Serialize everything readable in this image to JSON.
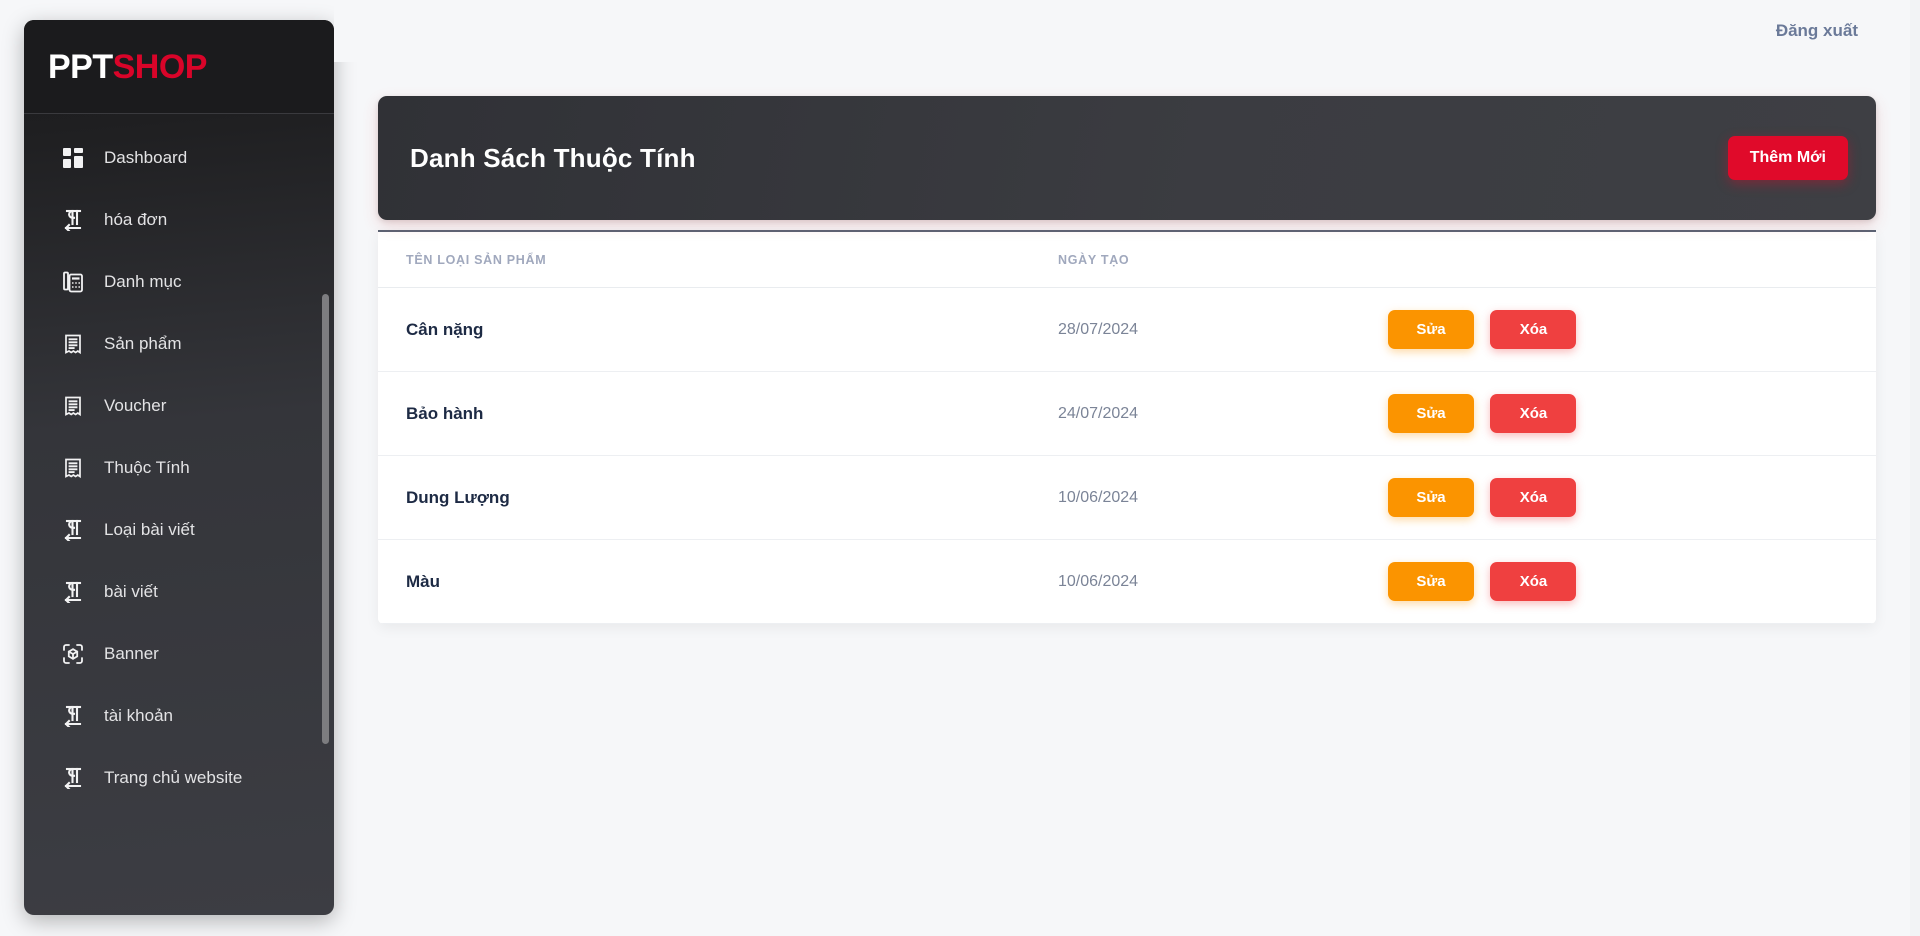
{
  "sidebar": {
    "logo": {
      "first": "PPT",
      "second": "SHOP"
    },
    "items": [
      {
        "label": "Dashboard",
        "icon": "dashboard-grid-icon"
      },
      {
        "label": "hóa đơn",
        "icon": "paragraph-mark-icon"
      },
      {
        "label": "Danh mục",
        "icon": "calculator-icon"
      },
      {
        "label": "Sản phẩm",
        "icon": "receipt-icon"
      },
      {
        "label": "Voucher",
        "icon": "receipt-icon"
      },
      {
        "label": "Thuộc Tính",
        "icon": "receipt-icon"
      },
      {
        "label": "Loại bài viết",
        "icon": "paragraph-mark-icon"
      },
      {
        "label": "bài viết",
        "icon": "paragraph-mark-icon"
      },
      {
        "label": "Banner",
        "icon": "cube-scan-icon"
      },
      {
        "label": "tài khoản",
        "icon": "paragraph-mark-icon"
      },
      {
        "label": "Trang chủ website",
        "icon": "paragraph-mark-icon"
      }
    ]
  },
  "topbar": {
    "logout_label": "Đăng xuất"
  },
  "card": {
    "title": "Danh Sách Thuộc Tính",
    "add_button_label": "Thêm Mới"
  },
  "table": {
    "columns": [
      "TÊN LOẠI SẢN PHẨM",
      "NGÀY TẠO",
      ""
    ],
    "rows": [
      {
        "name": "Cân nặng",
        "date": "28/07/2024",
        "edit_label": "Sửa",
        "delete_label": "Xóa"
      },
      {
        "name": "Bảo hành",
        "date": "24/07/2024",
        "edit_label": "Sửa",
        "delete_label": "Xóa"
      },
      {
        "name": "Dung Lượng",
        "date": "10/06/2024",
        "edit_label": "Sửa",
        "delete_label": "Xóa"
      },
      {
        "name": "Màu",
        "date": "10/06/2024",
        "edit_label": "Sửa",
        "delete_label": "Xóa"
      }
    ]
  },
  "colors": {
    "brand_red": "#d90429",
    "add_button": "#e00a2a",
    "edit_button": "#fb9400",
    "delete_button": "#ef4040",
    "sidebar_dark": "#34353a",
    "page_background": "#f6f7f9",
    "row_name_text": "#1d2a44",
    "muted_text": "#7b8497"
  }
}
